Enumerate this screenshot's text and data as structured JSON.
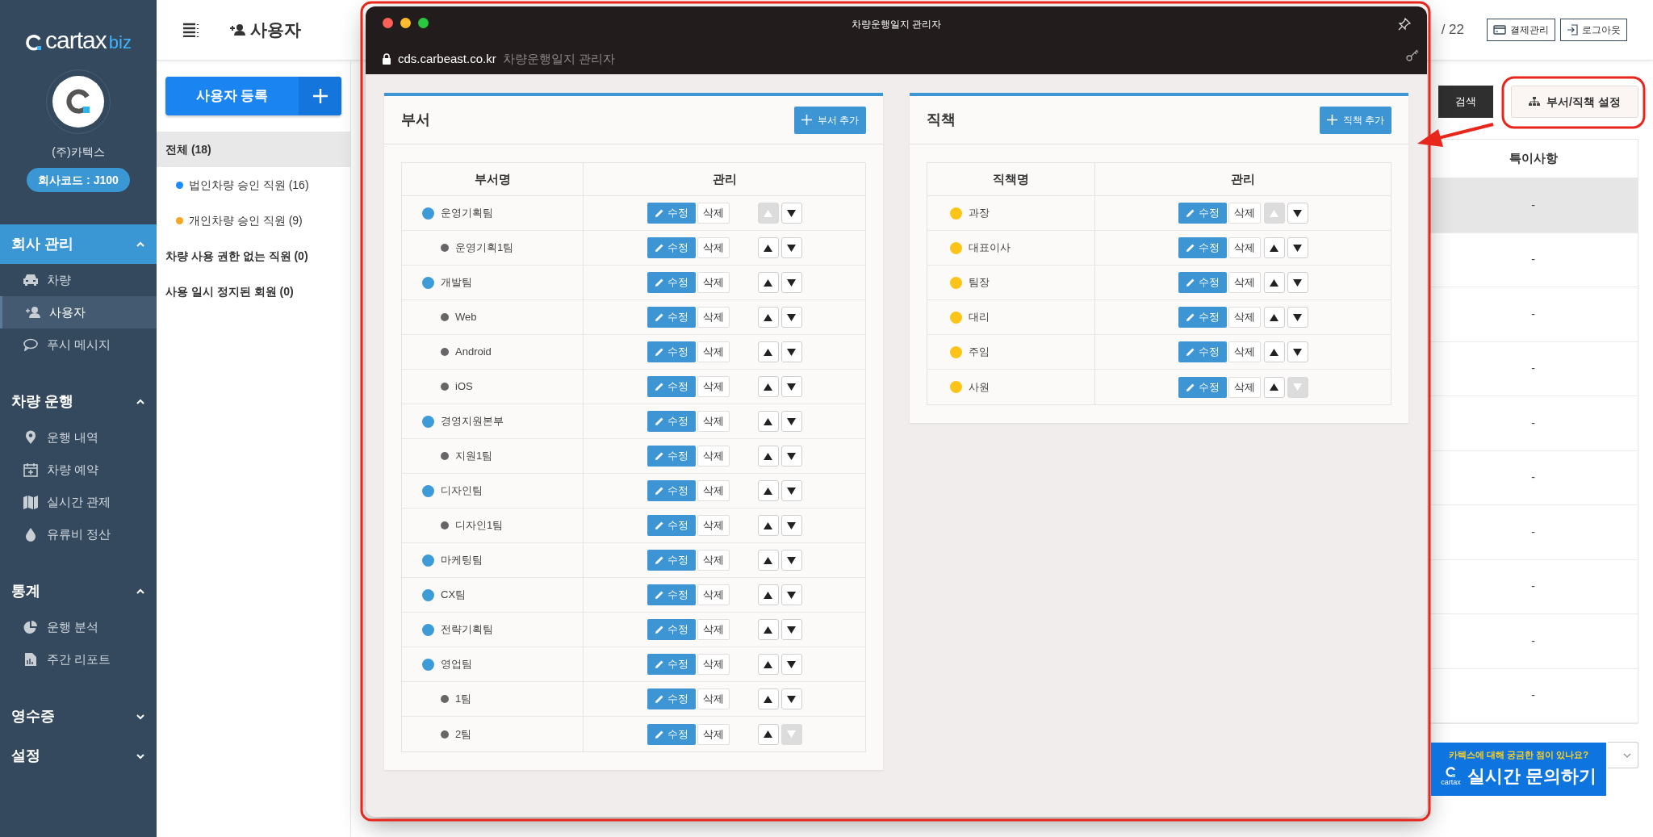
{
  "sidebar": {
    "logo": {
      "brand": "cartax",
      "suffix": "biz"
    },
    "company": "(주)카텍스",
    "company_code": "회사코드 : J100",
    "sections": [
      {
        "title": "회사 관리",
        "expanded": true,
        "active": true,
        "items": [
          {
            "label": "차량",
            "selected": false
          },
          {
            "label": "사용자",
            "selected": true
          },
          {
            "label": "푸시 메시지",
            "selected": false
          }
        ]
      },
      {
        "title": "차량 운행",
        "expanded": true,
        "active": false,
        "items": [
          {
            "label": "운행 내역",
            "selected": false
          },
          {
            "label": "차량 예약",
            "selected": false
          },
          {
            "label": "실시간 관제",
            "selected": false
          },
          {
            "label": "유류비 정산",
            "selected": false
          }
        ]
      },
      {
        "title": "통계",
        "expanded": true,
        "active": false,
        "items": [
          {
            "label": "운행 분석",
            "selected": false
          },
          {
            "label": "주간 리포트",
            "selected": false
          }
        ]
      },
      {
        "title": "영수증",
        "expanded": false,
        "active": false
      },
      {
        "title": "설정",
        "expanded": false,
        "active": false
      }
    ]
  },
  "topbar": {
    "title": "사용자",
    "page_count": "/ 22",
    "buttons": [
      "결제관리",
      "로그아웃"
    ]
  },
  "user_panel": {
    "register_button": "사용자 등록",
    "filters": [
      {
        "label": "전체 (18)",
        "selected": true,
        "children": [
          {
            "label": "법인차량 승인 직원 (16)",
            "color": "#1a8cff",
            "selected": false
          },
          {
            "label": "개인차량 승인 직원 (9)",
            "color": "#f5a623",
            "selected": false
          }
        ]
      },
      {
        "label": "차량 사용 권한 없는 직원 (0)",
        "selected": false
      },
      {
        "label": "사용 일시 정지된 회원 (0)",
        "selected": false
      }
    ]
  },
  "toolbar": {
    "search_button": "검색",
    "settings_button": "부서/직책 설정"
  },
  "table": {
    "columns": [
      "특이사항"
    ],
    "rows": [
      {
        "cells": [
          "-"
        ],
        "selected": true
      },
      {
        "cells": [
          "-"
        ],
        "selected": false
      },
      {
        "cells": [
          "-"
        ],
        "selected": false
      },
      {
        "cells": [
          "-"
        ],
        "selected": false
      },
      {
        "cells": [
          "-"
        ],
        "selected": false
      },
      {
        "cells": [
          "-"
        ],
        "selected": false
      },
      {
        "cells": [
          "-"
        ],
        "selected": false
      },
      {
        "cells": [
          "-"
        ],
        "selected": false
      },
      {
        "cells": [
          "-"
        ],
        "selected": false
      },
      {
        "cells": [
          "-"
        ],
        "selected": false
      }
    ]
  },
  "chat_banner": {
    "question": "카텍스에 대해 궁금한 점이 있나요?",
    "logo": "cartax",
    "action": "실시간 문의하기"
  },
  "popup": {
    "title": "차량운행일지 관리자",
    "url": "cds.carbeast.co.kr",
    "page_title": "차량운행일지 관리자",
    "panels": [
      {
        "kind": "department",
        "title": "부서",
        "add_button": "부서 추가",
        "columns": [
          "부서명",
          "관리"
        ],
        "rows": [
          {
            "name": "운영기획팀",
            "edit": "수정",
            "delete": "삭제",
            "up_enabled": false,
            "down_enabled": true,
            "children": [
              {
                "name": "운영기획1팀",
                "edit": "수정",
                "delete": "삭제",
                "up_enabled": true,
                "down_enabled": true
              }
            ]
          },
          {
            "name": "개발팀",
            "edit": "수정",
            "delete": "삭제",
            "up_enabled": true,
            "down_enabled": true,
            "children": [
              {
                "name": "Web",
                "edit": "수정",
                "delete": "삭제",
                "up_enabled": true,
                "down_enabled": true
              },
              {
                "name": "Android",
                "edit": "수정",
                "delete": "삭제",
                "up_enabled": true,
                "down_enabled": true
              },
              {
                "name": "iOS",
                "edit": "수정",
                "delete": "삭제",
                "up_enabled": true,
                "down_enabled": true
              }
            ]
          },
          {
            "name": "경영지원본부",
            "edit": "수정",
            "delete": "삭제",
            "up_enabled": true,
            "down_enabled": true,
            "children": [
              {
                "name": "지원1팀",
                "edit": "수정",
                "delete": "삭제",
                "up_enabled": true,
                "down_enabled": true
              }
            ]
          },
          {
            "name": "디자인팀",
            "edit": "수정",
            "delete": "삭제",
            "up_enabled": true,
            "down_enabled": true,
            "children": [
              {
                "name": "디자인1팀",
                "edit": "수정",
                "delete": "삭제",
                "up_enabled": true,
                "down_enabled": true
              }
            ]
          },
          {
            "name": "마케팅팀",
            "edit": "수정",
            "delete": "삭제",
            "up_enabled": true,
            "down_enabled": true
          },
          {
            "name": "CX팀",
            "edit": "수정",
            "delete": "삭제",
            "up_enabled": true,
            "down_enabled": true
          },
          {
            "name": "전략기획팀",
            "edit": "수정",
            "delete": "삭제",
            "up_enabled": true,
            "down_enabled": true
          },
          {
            "name": "영업팀",
            "edit": "수정",
            "delete": "삭제",
            "up_enabled": true,
            "down_enabled": true,
            "children": [
              {
                "name": "1팀",
                "edit": "수정",
                "delete": "삭제",
                "up_enabled": true,
                "down_enabled": true
              },
              {
                "name": "2팀",
                "edit": "수정",
                "delete": "삭제",
                "up_enabled": true,
                "down_enabled": false
              }
            ]
          }
        ]
      },
      {
        "kind": "position",
        "title": "직책",
        "add_button": "직책 추가",
        "columns": [
          "직책명",
          "관리"
        ],
        "rows": [
          {
            "name": "과장",
            "edit": "수정",
            "delete": "삭제",
            "up_enabled": false,
            "down_enabled": true
          },
          {
            "name": "대표이사",
            "edit": "수정",
            "delete": "삭제",
            "up_enabled": true,
            "down_enabled": true
          },
          {
            "name": "팀장",
            "edit": "수정",
            "delete": "삭제",
            "up_enabled": true,
            "down_enabled": true
          },
          {
            "name": "대리",
            "edit": "수정",
            "delete": "삭제",
            "up_enabled": true,
            "down_enabled": true
          },
          {
            "name": "주임",
            "edit": "수정",
            "delete": "삭제",
            "up_enabled": true,
            "down_enabled": true
          },
          {
            "name": "사원",
            "edit": "수정",
            "delete": "삭제",
            "up_enabled": true,
            "down_enabled": false
          }
        ]
      }
    ]
  }
}
